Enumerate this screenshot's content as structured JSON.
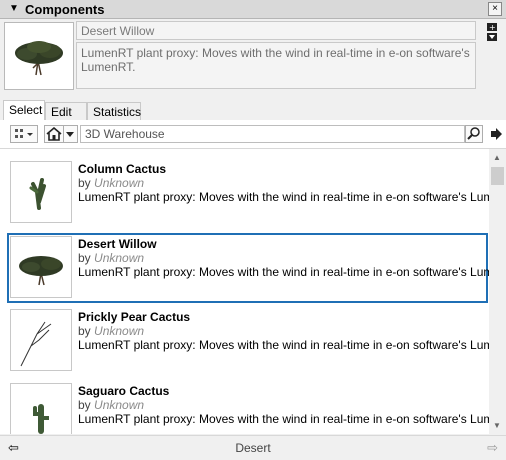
{
  "panel": {
    "title": "Components",
    "collapse_glyph": "▼",
    "close_glyph": "×"
  },
  "selected": {
    "name": "Desert Willow",
    "description": "LumenRT plant proxy: Moves with the wind in real-time in e-on software's LumenRT."
  },
  "tabs": [
    {
      "label": "Select"
    },
    {
      "label": "Edit"
    },
    {
      "label": "Statistics"
    }
  ],
  "toolbar": {
    "search_value": "3D Warehouse"
  },
  "items": [
    {
      "name": "Column Cactus",
      "by": "by",
      "author": "Unknown",
      "desc": "LumenRT plant proxy: Moves with the wind in real-time in e-on software's LumenRT."
    },
    {
      "name": "Desert Willow",
      "by": "by",
      "author": "Unknown",
      "desc": "LumenRT plant proxy: Moves with the wind in real-time in e-on software's LumenRT."
    },
    {
      "name": "Prickly Pear Cactus",
      "by": "by",
      "author": "Unknown",
      "desc": "LumenRT plant proxy: Moves with the wind in real-time in e-on software's LumenRT."
    },
    {
      "name": "Saguaro Cactus",
      "by": "by",
      "author": "Unknown",
      "desc": "LumenRT plant proxy: Moves with the wind in real-time in e-on software's LumenRT."
    }
  ],
  "footer": {
    "label": "Desert"
  },
  "colors": {
    "selection_border": "#1f6fb5"
  }
}
